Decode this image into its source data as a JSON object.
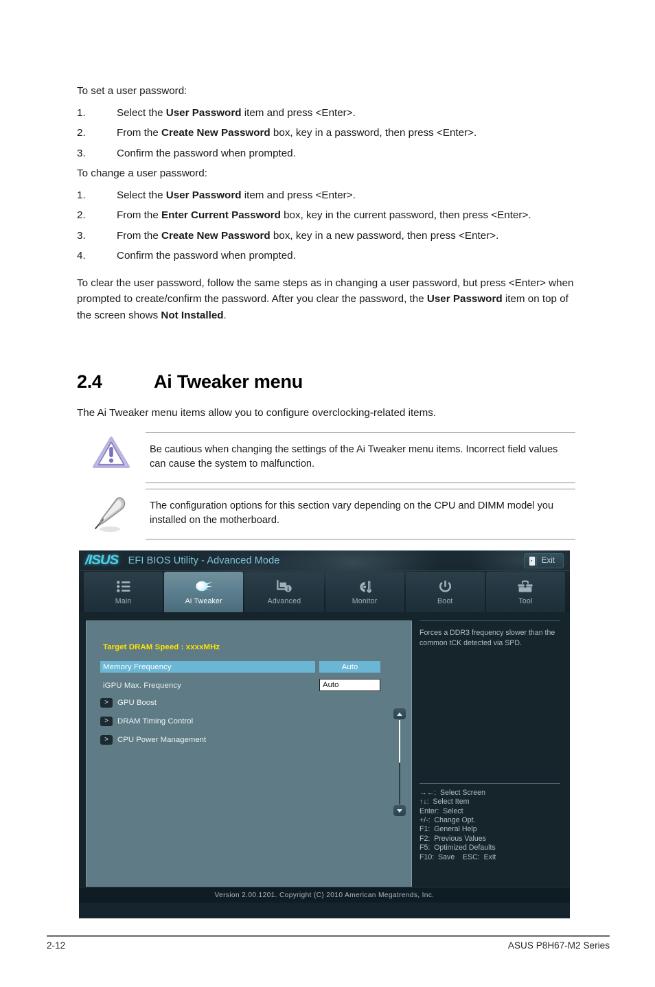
{
  "doc": {
    "intro_set": "To set a user password:",
    "set_steps": [
      {
        "num": "1.",
        "pre": "Select the ",
        "bold": "User Password",
        "post": " item and press <Enter>."
      },
      {
        "num": "2.",
        "pre": "From the ",
        "bold": "Create New Password",
        "post": " box, key in a password, then press <Enter>."
      },
      {
        "num": "3.",
        "pre": "Confirm the password when prompted.",
        "bold": "",
        "post": ""
      }
    ],
    "intro_change": "To change a user password:",
    "change_steps": [
      {
        "num": "1.",
        "pre": "Select the ",
        "bold": "User Password",
        "post": " item and press <Enter>."
      },
      {
        "num": "2.",
        "pre": "From the ",
        "bold": "Enter Current Password",
        "post": " box, key in the current password, then press <Enter>."
      },
      {
        "num": "3.",
        "pre": "From the ",
        "bold": "Create New Password",
        "post": " box, key in a new password, then press <Enter>."
      },
      {
        "num": "4.",
        "pre": "Confirm the password when prompted.",
        "bold": "",
        "post": ""
      }
    ],
    "clear_para_1": "To clear the user password, follow the same steps as in changing a user password, but press <Enter> when prompted to create/confirm the password. After you clear the password, the ",
    "clear_para_bold_1": "User Password",
    "clear_para_2": " item on top of the screen shows ",
    "clear_para_bold_2": "Not Installed",
    "clear_para_3": "."
  },
  "section": {
    "number": "2.4",
    "title": "Ai Tweaker menu",
    "intro": "The Ai Tweaker menu items allow you to configure overclocking-related items."
  },
  "notes": [
    {
      "icon": "warning-triangle-icon",
      "text": "Be cautious when changing the settings of the Ai Tweaker menu items. Incorrect field values can cause the system to malfunction."
    },
    {
      "icon": "pencil-note-icon",
      "text": "The configuration options for this section vary depending on the CPU and DIMM model you installed on the motherboard."
    }
  ],
  "bios": {
    "brand": "/ISUS",
    "title": "EFI BIOS Utility - Advanced Mode",
    "exit_label": "Exit",
    "accent_cyan": "#4fd2e8",
    "highlight_blue": "#6bb6d4",
    "warn_yellow": "#ffe400",
    "panel_slate": "#5e7b86",
    "tabs": [
      {
        "label": "Main",
        "icon": "list-icon",
        "active": false
      },
      {
        "label": "Ai  Tweaker",
        "icon": "comet-icon",
        "active": true
      },
      {
        "label": "Advanced",
        "icon": "monitor-info-icon",
        "active": false
      },
      {
        "label": "Monitor",
        "icon": "gauge-thermometer-icon",
        "active": false
      },
      {
        "label": "Boot",
        "icon": "power-icon",
        "active": false
      },
      {
        "label": "Tool",
        "icon": "toolbox-icon",
        "active": false
      }
    ],
    "dram_speed": "Target DRAM Speed :  xxxxMHz",
    "items": [
      {
        "label": "Memory Frequency",
        "value": "Auto",
        "kind": "selected-pill"
      },
      {
        "label": "iGPU Max. Frequency",
        "value": "Auto",
        "kind": "input"
      }
    ],
    "submenus": [
      {
        "marker": ">",
        "label": "GPU Boost"
      },
      {
        "marker": ">",
        "label": "DRAM Timing Control"
      },
      {
        "marker": ">",
        "label": "CPU Power Management"
      }
    ],
    "help_text": "Forces a DDR3 frequency slower than the common tCK detected via SPD.",
    "shortcuts": [
      "→←:  Select Screen",
      "↑↓:  Select Item",
      "Enter:  Select",
      "+/-:  Change Opt.",
      "F1:  General Help",
      "F2:  Previous Values",
      "F5:  Optimized Defaults",
      "F10:  Save    ESC:  Exit"
    ],
    "footer": "Version  2.00.1201.   Copyright  (C)  2010  American  Megatrends,  Inc."
  },
  "page": {
    "number": "2-12",
    "model": "ASUS P8H67-M2 Series"
  }
}
